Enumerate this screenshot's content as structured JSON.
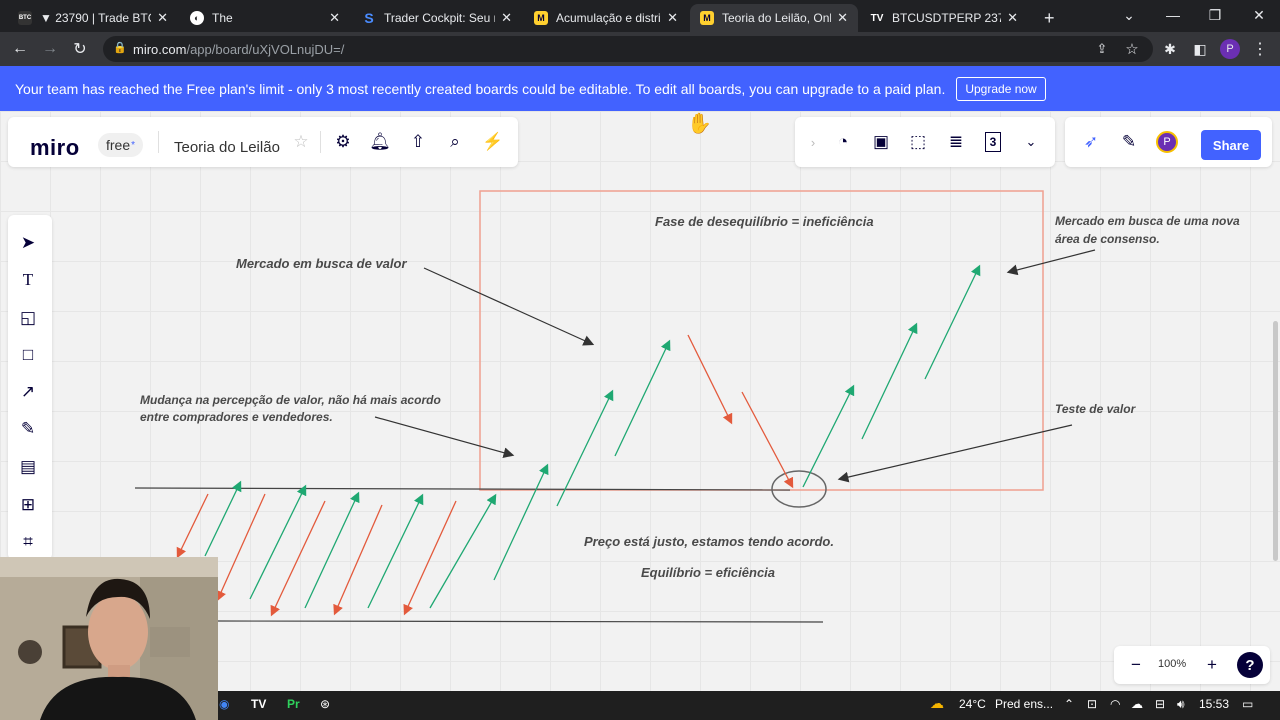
{
  "browser": {
    "tabs": [
      {
        "title": "▼ 23790 | Trade BTCU",
        "favicon": "BTC",
        "active": false
      },
      {
        "title": "The",
        "favicon": "globe",
        "active": false
      },
      {
        "title": "Trader Cockpit: Seu n",
        "favicon": "S",
        "active": false
      },
      {
        "title": "Acumulação e distribu",
        "favicon": "M",
        "active": false
      },
      {
        "title": "Teoria do Leilão, Onli",
        "favicon": "M",
        "active": true
      },
      {
        "title": "BTCUSDTPERP 23794.",
        "favicon": "TV",
        "active": false
      }
    ],
    "url_host": "miro.com",
    "url_path": "/app/board/uXjVOLnujDU=/",
    "new_tab": "+",
    "avatar_letter": "P"
  },
  "banner": {
    "text": "Your team has reached the Free plan's limit - only 3 most recently created boards could be editable. To edit all boards, you can upgrade to a paid plan.",
    "upgrade_label": "Upgrade now"
  },
  "miro": {
    "logo": "miro",
    "plan": "free",
    "plan_mark": "*",
    "board_name": "Teoria do Leilão",
    "share_label": "Share",
    "avatar_letter": "P",
    "zoom": "100%",
    "help": "?",
    "counter": "3",
    "tools": [
      "cursor-icon",
      "text-icon",
      "sticky-note-icon",
      "shape-icon",
      "arrow-tool-icon",
      "pen-icon",
      "comment-icon",
      "frame-icon",
      "crop-icon"
    ],
    "colors": {
      "accent": "#4262ff",
      "green": "#1fa872",
      "red": "#e35a3c",
      "frame": "#f0a090"
    }
  },
  "notes": {
    "phase": "Fase de desequilíbrio = ineficiência",
    "market_value": "Mercado em busca de valor",
    "new_area_1": "Mercado em busca de uma nova",
    "new_area_2": "área de consenso.",
    "change_1": "Mudança na percepção de valor, não há mais acordo",
    "change_2": "entre compradores e vendedores.",
    "value_test": "Teste de valor",
    "fair_price": "Preço está justo, estamos tendo acordo.",
    "equilibrium": "Equilíbrio = eficiência"
  },
  "taskbar": {
    "weather": "24°C",
    "weather_text": "Pred ens...",
    "time": "15:53"
  }
}
